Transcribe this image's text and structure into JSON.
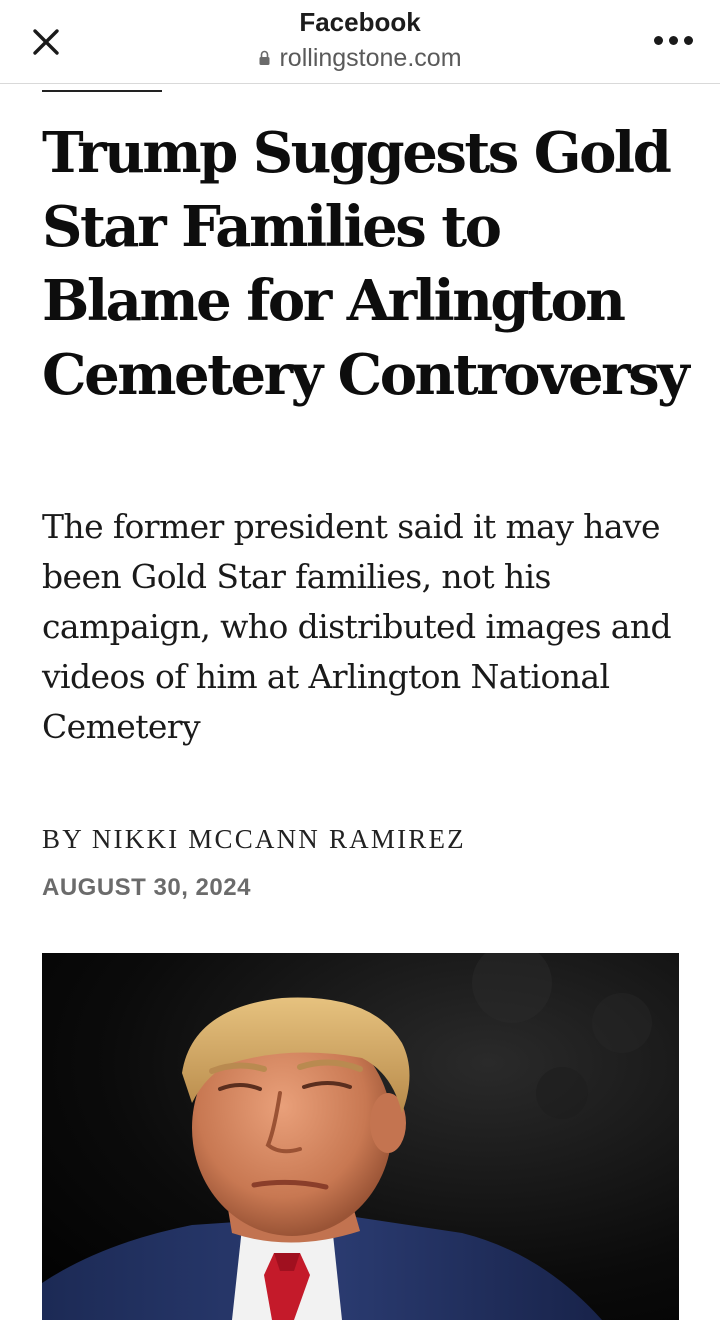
{
  "topbar": {
    "app_title": "Facebook",
    "url": "rollingstone.com",
    "close_icon": "close-icon",
    "lock_icon": "lock-icon",
    "more_icon": "more-options-icon"
  },
  "article": {
    "headline": "Trump Suggests Gold Star Families to Blame for Arlington Cemetery Controversy",
    "dek": "The former president said it may have been Gold Star families, not his campaign, who distributed images and videos of him at Arlington National Cemetery",
    "byline": "BY NIKKI MCCANN RAMIREZ",
    "date": "AUGUST 30, 2024"
  },
  "colors": {
    "text": "#0d0d0d",
    "date": "#6b6b6b",
    "url": "#5a5a5a",
    "hero_bg": "#000000"
  }
}
